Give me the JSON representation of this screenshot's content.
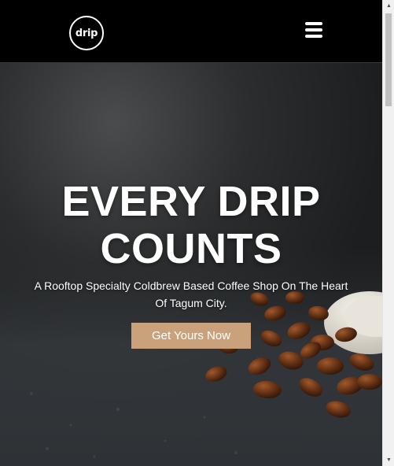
{
  "header": {
    "logo_text": "drip",
    "menu_icon": "hamburger-menu-icon"
  },
  "hero": {
    "headline_line1": "EVERY DRIP",
    "headline_line2": "COUNTS",
    "subtitle": "A Rooftop Specialty Coldbrew Based Coffee Shop On The Heart Of Tagum City.",
    "cta_label": "Get Yours Now",
    "background_image": "coffee-beans-and-cup-photo"
  },
  "colors": {
    "header_bg": "#000000",
    "cta_bg": "#c9a27b",
    "text": "#ffffff"
  },
  "scrollbar": {
    "up_icon": "scroll-up-arrow-icon",
    "down_icon": "scroll-down-arrow-icon"
  }
}
